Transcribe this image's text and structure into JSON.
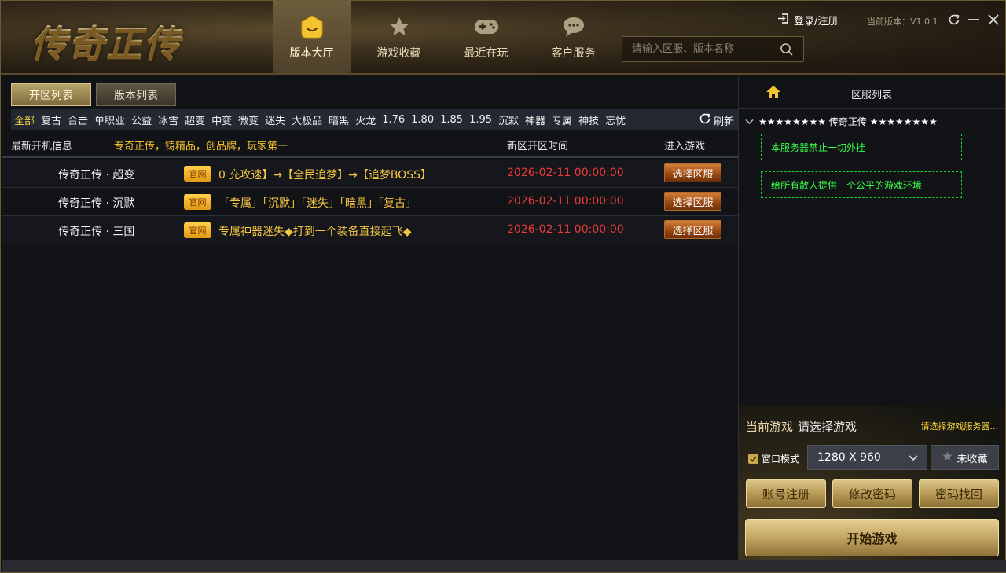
{
  "app": {
    "logo": "传奇正传"
  },
  "nav": [
    {
      "label": "版本大厅",
      "icon": "smile-icon",
      "active": true
    },
    {
      "label": "游戏收藏",
      "icon": "star-icon"
    },
    {
      "label": "最近在玩",
      "icon": "gamepad-icon"
    },
    {
      "label": "客户服务",
      "icon": "chat-icon"
    }
  ],
  "search": {
    "placeholder": "请输入区服、版本名称"
  },
  "header": {
    "login": "登录/注册",
    "version": "当前版本：V1.0.1"
  },
  "subtabs": [
    {
      "label": "开区列表",
      "active": true
    },
    {
      "label": "版本列表"
    }
  ],
  "filters": [
    "全部",
    "复古",
    "合击",
    "单职业",
    "公益",
    "冰雪",
    "超变",
    "中变",
    "微变",
    "迷失",
    "大极品",
    "暗黑",
    "火龙",
    "1.76",
    "1.80",
    "1.85",
    "1.95",
    "沉默",
    "神器",
    "专属",
    "神技",
    "忘忧"
  ],
  "refresh": "刷新",
  "list_header": {
    "info": "最新开机信息",
    "slogan": "专奇正传，铸精品，创品牌，玩家第一",
    "time": "新区开区时间",
    "enter": "进入游戏"
  },
  "rows": [
    {
      "name": "传奇正传 · 超变",
      "badge": "官网",
      "desc": "0 充攻速】→【全民追梦】→【追梦BOSS】",
      "time": "2026-02-11 00:00:00",
      "button": "选择区服"
    },
    {
      "name": "传奇正传 · 沉默",
      "badge": "官网",
      "desc": "「专属」「沉默」「迷失」「暗黑」「复古」",
      "time": "2026-02-11 00:00:00",
      "button": "选择区服"
    },
    {
      "name": "传奇正传 · 三国",
      "badge": "官网",
      "desc": "专属神器迷失◆打到一个装备直接起飞◆",
      "time": "2026-02-11 00:00:00",
      "button": "选择区服"
    }
  ],
  "right": {
    "title": "区服列表",
    "tree_label": "★★★★★★★★ 传奇正传 ★★★★★★★★",
    "notices": [
      "本服务器禁止一切外挂",
      "给所有散人提供一个公平的游戏环境"
    ],
    "current_label": "当前游戏",
    "current_value": "请选择游戏",
    "current_tip": "请选择游戏服务器...",
    "window_mode": "窗口模式",
    "resolution": "1280 X 960",
    "favorite": "未收藏",
    "buttons": [
      "账号注册",
      "修改密码",
      "密码找回"
    ],
    "start": "开始游戏"
  },
  "colors": {
    "accent_gold": "#f5c542",
    "time_red": "#f03b3b",
    "notice_green": "#39ff4a",
    "active_filter": "#f5d33a"
  }
}
